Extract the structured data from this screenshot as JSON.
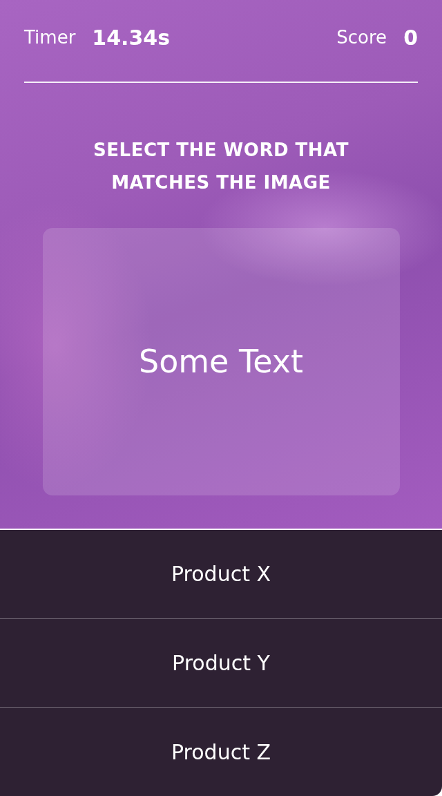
{
  "header": {
    "timer_label": "Timer",
    "timer_value": "14.34s",
    "score_label": "Score",
    "score_value": "0"
  },
  "prompt": "SELECT THE WORD THAT MATCHES THE IMAGE",
  "image_card": {
    "text": "Some Text"
  },
  "options": [
    {
      "label": "Product X"
    },
    {
      "label": "Product Y"
    },
    {
      "label": "Product Z"
    }
  ]
}
